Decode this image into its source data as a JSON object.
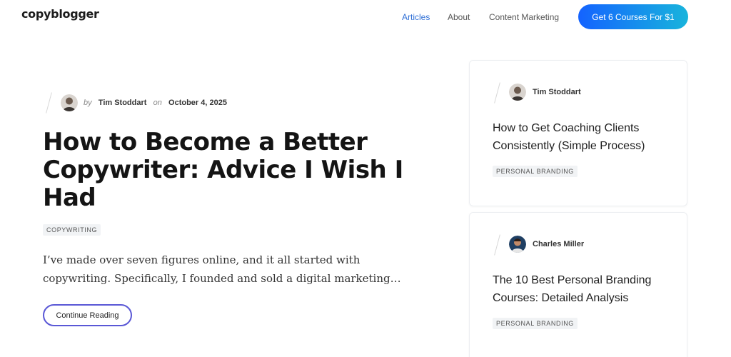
{
  "header": {
    "logo": "copyblogger",
    "nav": [
      "Articles",
      "About",
      "Content Marketing"
    ],
    "cta": "Get 6 Courses For $1",
    "active_color": "#2f6fd6",
    "cta_gradient": [
      "#1463ff",
      "#18b4dc"
    ]
  },
  "featured": {
    "by": "by",
    "author": "Tim Stoddart",
    "on": "on",
    "date": "October 4, 2025",
    "title": "How to Become a Better Copywriter: Advice I Wish I Had",
    "tag": "COPYWRITING",
    "excerpt": "I’ve made over seven figures online, and it all started with copywriting. Specifically, I founded and sold a digital marketing…",
    "button": "Continue Reading"
  },
  "sidebar": {
    "cards": [
      {
        "author": "Tim Stoddart",
        "title": "How to Get Coaching Clients Consistently (Simple Process)",
        "tag": "PERSONAL BRANDING"
      },
      {
        "author": "Charles Miller",
        "title": "The 10 Best Personal Branding Courses: Detailed Analysis",
        "tag": "PERSONAL BRANDING"
      }
    ]
  },
  "icons": [
    "author-avatar-icon",
    "author-avatar-icon",
    "author-avatar-icon"
  ]
}
